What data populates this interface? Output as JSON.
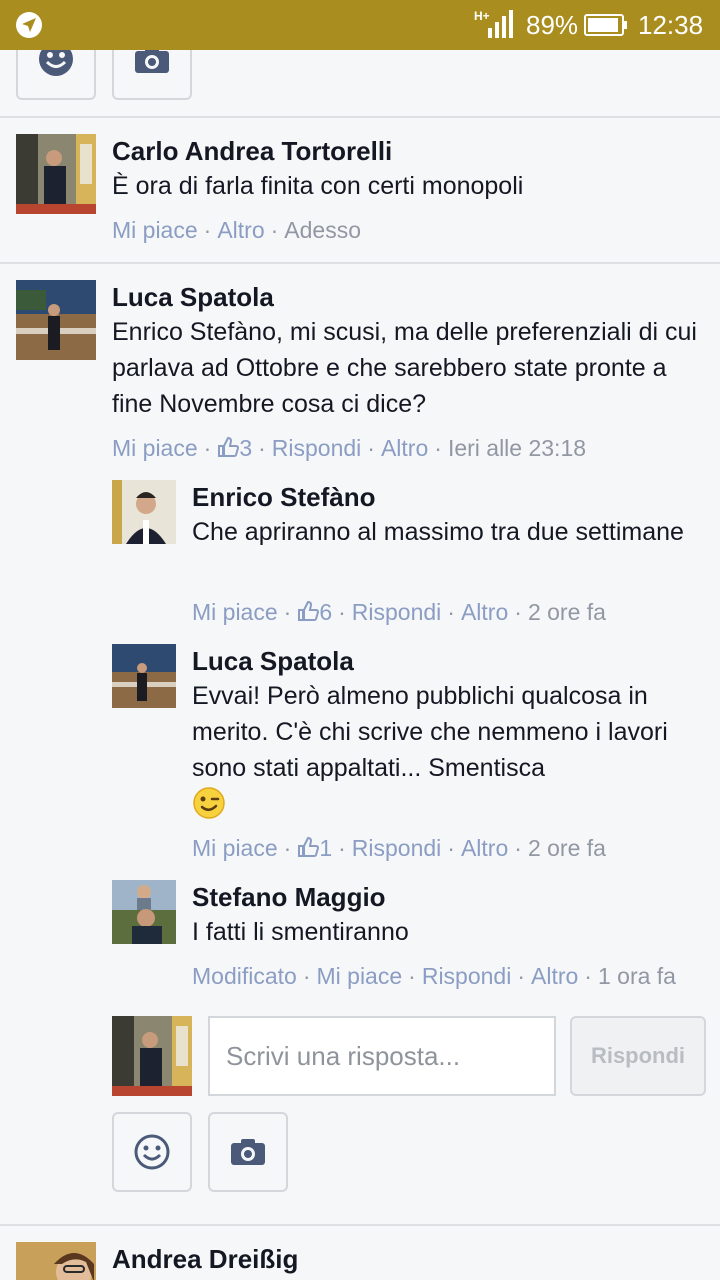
{
  "status_bar": {
    "battery": "89%",
    "time": "12:38",
    "network": "H+"
  },
  "comments": [
    {
      "author": "Carlo Andrea Tortorelli",
      "text": "È ora di farla finita con certi monopoli",
      "like": "Mi piace",
      "more": "Altro",
      "time": "Adesso"
    },
    {
      "author": "Luca Spatola",
      "text": "Enrico Stefàno, mi scusi, ma delle preferenziali di cui parlava ad Ottobre e che sarebbero state pronte a fine Novembre cosa ci dice?",
      "like": "Mi piace",
      "likes_count": "3",
      "reply": "Rispondi",
      "more": "Altro",
      "time": "Ieri alle 23:18"
    }
  ],
  "replies": [
    {
      "author": "Enrico Stefàno",
      "text": "Che apriranno al massimo tra due settimane",
      "like": "Mi piace",
      "likes_count": "6",
      "reply": "Rispondi",
      "more": "Altro",
      "time": "2 ore fa"
    },
    {
      "author": "Luca Spatola",
      "text": "Evvai! Però almeno pubblichi qualcosa in merito. C'è chi scrive che nemmeno i lavori sono stati appaltati... Smentisca",
      "like": "Mi piace",
      "likes_count": "1",
      "reply": "Rispondi",
      "more": "Altro",
      "time": "2 ore fa"
    },
    {
      "author": "Stefano Maggio",
      "text": "I fatti li smentiranno",
      "edited": "Modificato",
      "like": "Mi piace",
      "reply": "Rispondi",
      "more": "Altro",
      "time": "1 ora fa"
    }
  ],
  "reply_box": {
    "placeholder": "Scrivi una risposta...",
    "submit_label": "Rispondi"
  },
  "next_comment": {
    "author": "Andrea Dreißig"
  },
  "icons": {
    "emoji": "smiley-icon",
    "camera": "camera-icon",
    "thumb": "thumbs-up-icon",
    "location": "location-arrow-icon",
    "wink": "wink-emoji-icon"
  },
  "colors": {
    "status_bar": "#a98d1f",
    "link": "#8b9dc3",
    "text": "#141823",
    "background": "#f6f7f9"
  }
}
